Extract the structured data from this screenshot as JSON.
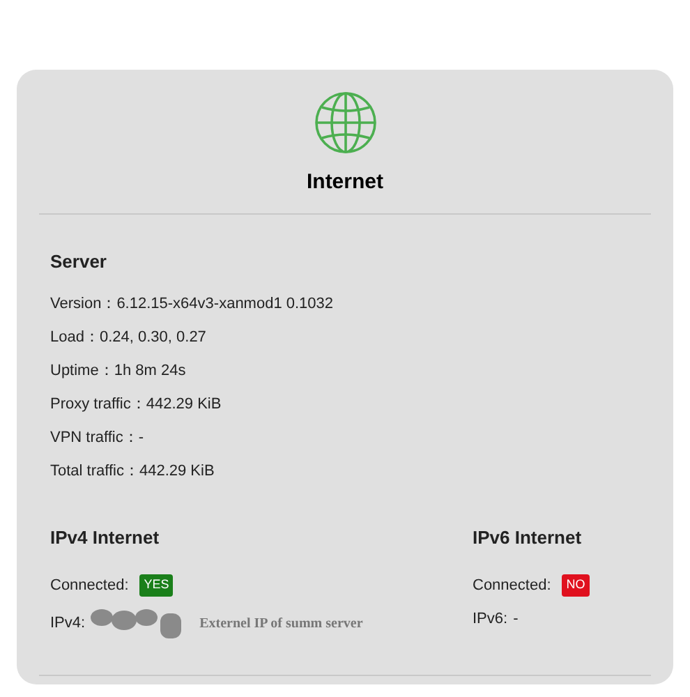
{
  "title": "Internet",
  "server": {
    "heading": "Server",
    "rows": [
      "Version：6.12.15-x64v3-xanmod1 0.1032",
      "Load：0.24, 0.30, 0.27",
      "Uptime：1h 8m 24s",
      "Proxy traffic：442.29 KiB",
      "VPN traffic：-",
      "Total traffic：442.29 KiB"
    ]
  },
  "networks": [
    {
      "heading": "IPv4 Internet",
      "connected_label": "Connected:",
      "connected": true,
      "badge": "YES",
      "address_label": "IPv4:",
      "address_redacted": true,
      "note": "Externel IP of summ server"
    },
    {
      "heading": "IPv6 Internet",
      "connected_label": "Connected:",
      "connected": false,
      "badge": "NO",
      "address_label": "IPv6:",
      "address": "-"
    }
  ]
}
